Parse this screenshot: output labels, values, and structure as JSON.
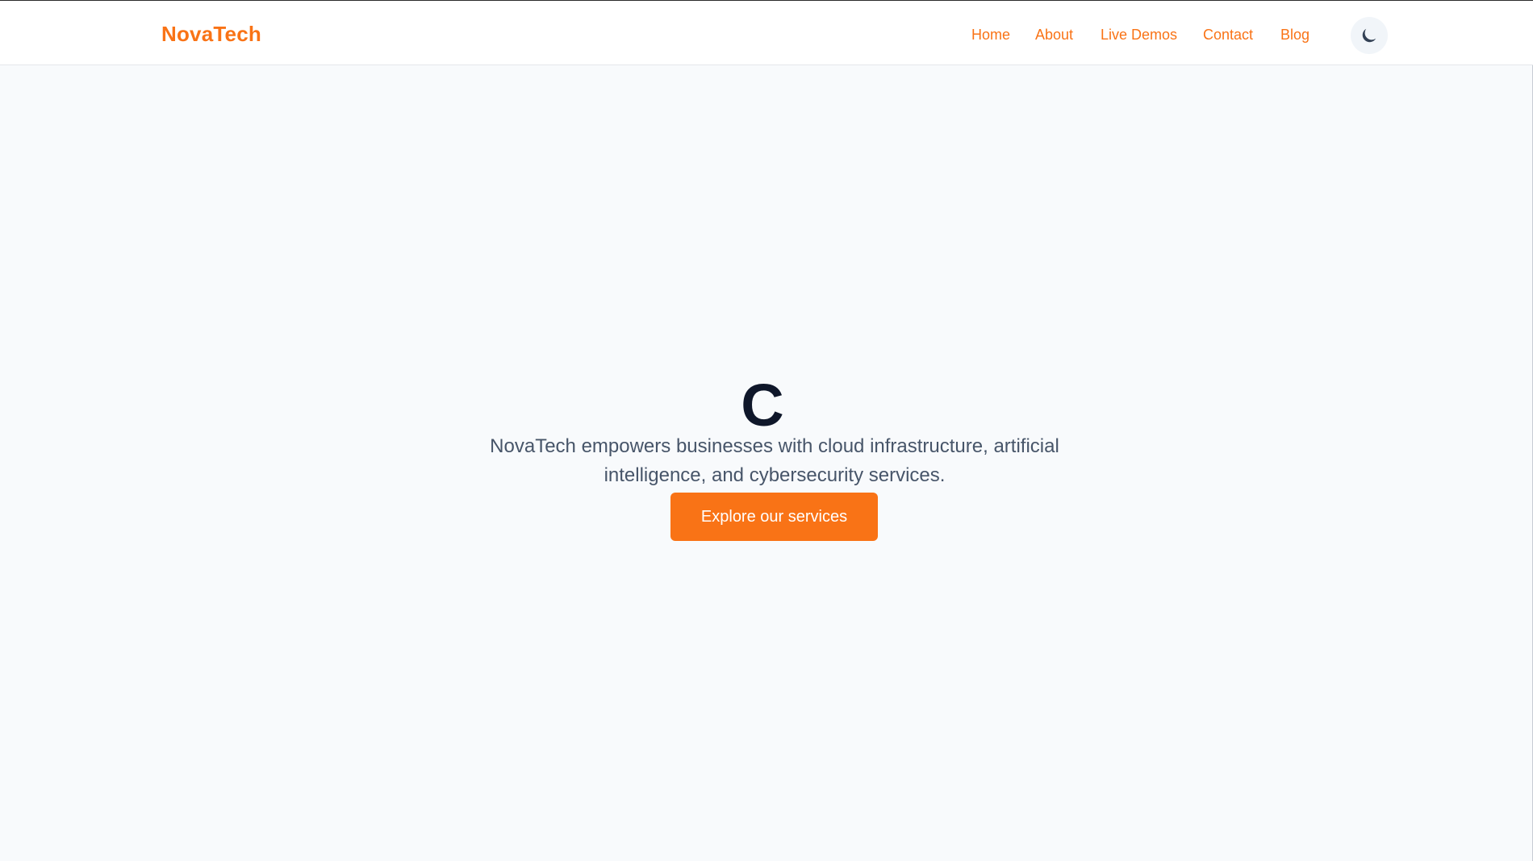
{
  "header": {
    "brand": "NovaTech",
    "nav": {
      "home": "Home",
      "about": "About",
      "live_demos": "Live Demos",
      "contact": "Contact",
      "blog": "Blog"
    },
    "theme_icon": "moon-icon"
  },
  "hero": {
    "title": "C",
    "description": "NovaTech empowers businesses with cloud infrastructure, artificial intelligence, and cybersecurity services.",
    "cta": "Explore our services"
  },
  "colors": {
    "accent": "#f97316",
    "page_background": "#f8fafc",
    "heading": "#0f172a",
    "body_text": "#475569"
  }
}
